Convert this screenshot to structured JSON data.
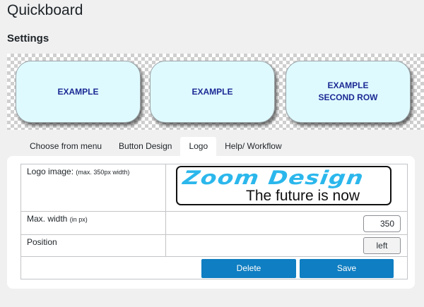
{
  "app": {
    "title": "Quickboard"
  },
  "settings_title": "Settings",
  "preview": {
    "buttons": [
      {
        "label": "EXAMPLE"
      },
      {
        "label": "EXAMPLE"
      },
      {
        "label": "EXAMPLE\nSECOND ROW"
      }
    ]
  },
  "tabs": [
    {
      "label": "Choose from menu",
      "active": false
    },
    {
      "label": "Button Design",
      "active": false
    },
    {
      "label": "Logo",
      "active": true
    },
    {
      "label": "Help/ Workflow",
      "active": false
    }
  ],
  "logo_form": {
    "logo_image": {
      "label": "Logo image:",
      "hint": "(max. 350px width)"
    },
    "logo_preview": {
      "line1": "Zoom Design",
      "line2": "The future is now"
    },
    "max_width": {
      "label": "Max. width",
      "hint": "(in px)",
      "value": "350"
    },
    "position": {
      "label": "Position",
      "value": "left"
    },
    "delete_label": "Delete",
    "save_label": "Save"
  },
  "colors": {
    "accent": "#0f7ec2",
    "preview_button_bg": "#dffaff",
    "preview_button_text": "#1b2a94",
    "logo_blue": "#2bb7ec"
  }
}
